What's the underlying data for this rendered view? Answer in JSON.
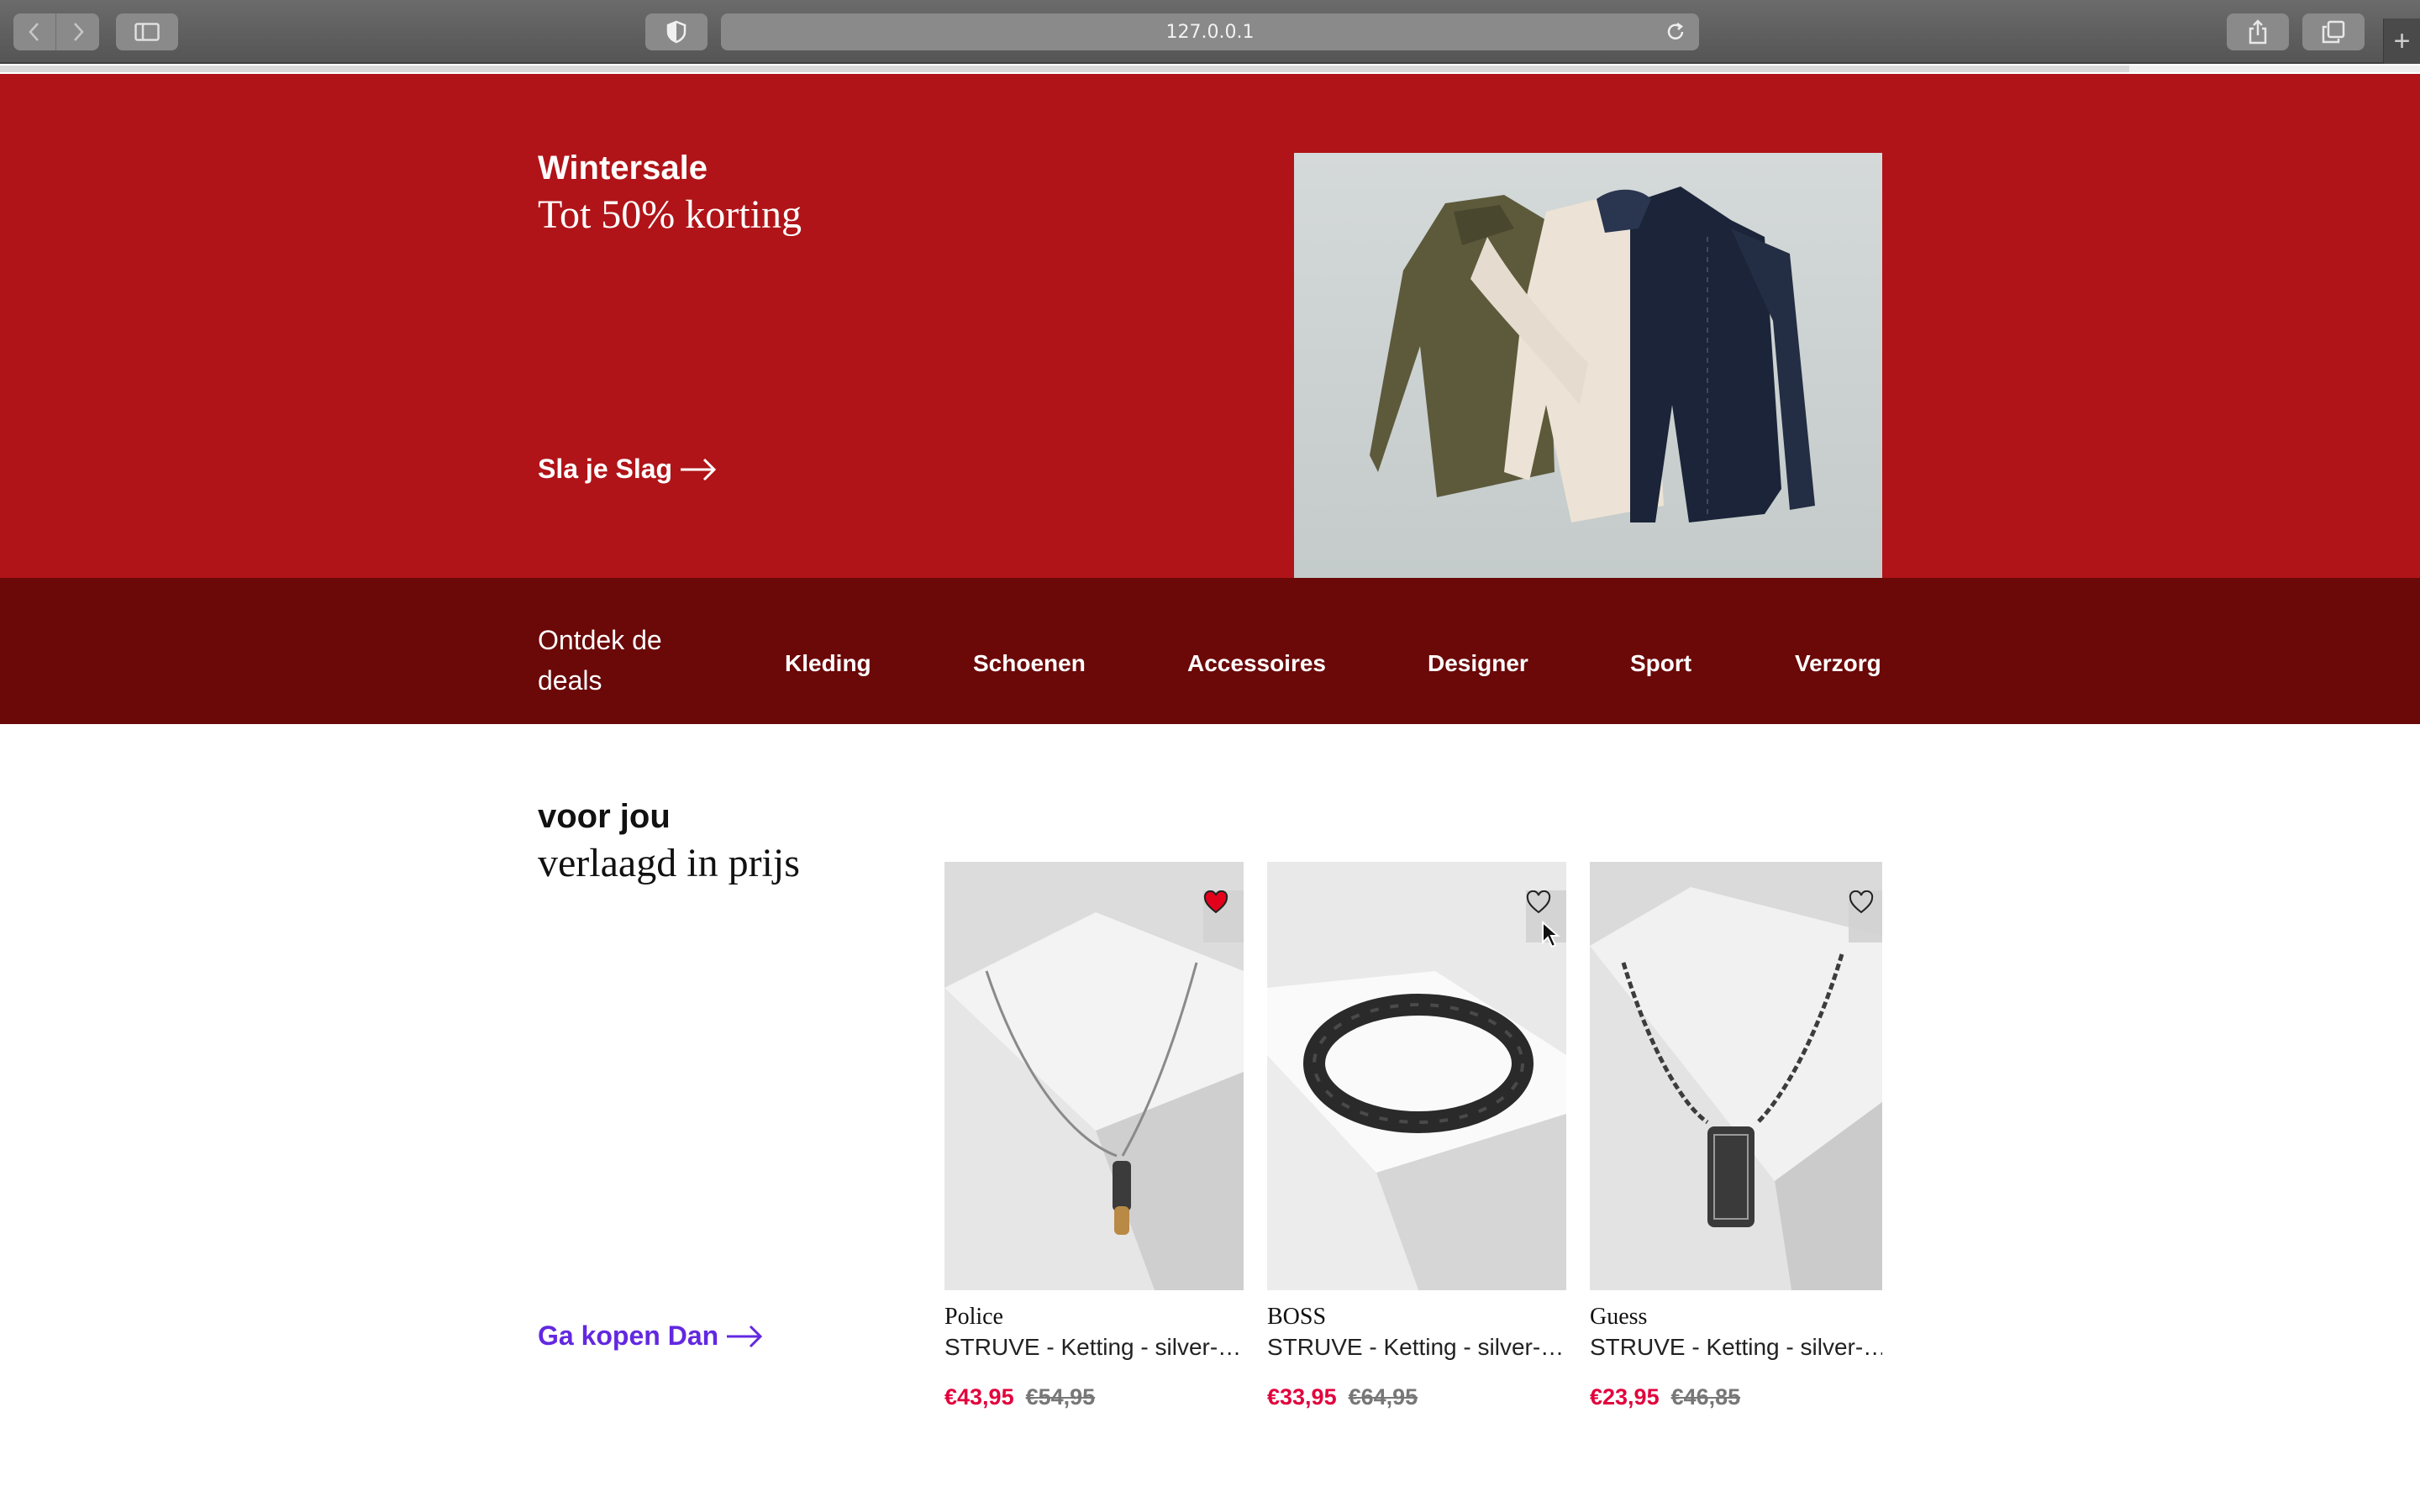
{
  "browser": {
    "url": "127.0.0.1",
    "load_progress": 0.88
  },
  "hero": {
    "kicker": "Wintersale",
    "title": "Tot 50% korting",
    "cta_label": "Sla je Slag",
    "image_alt_icon": "jackets-photo"
  },
  "category_nav": {
    "intro": "Ontdek de deals",
    "items": [
      {
        "label": "Kleding"
      },
      {
        "label": "Schoenen"
      },
      {
        "label": "Accessoires"
      },
      {
        "label": "Designer"
      },
      {
        "label": "Sport"
      },
      {
        "label": "Verzorgi"
      }
    ]
  },
  "deals": {
    "kicker": "voor jou",
    "title": "verlaagd in prijs",
    "cta_label": "Ga kopen Dan",
    "products": [
      {
        "brand": "Police",
        "name": "STRUVE - Ketting - silver-…",
        "price": "€43,95",
        "old_price": "€54,95",
        "favorited": true,
        "image": "necklace-pendant"
      },
      {
        "brand": "BOSS",
        "name": "STRUVE - Ketting - silver-…",
        "price": "€33,95",
        "old_price": "€64,95",
        "favorited": false,
        "image": "bracelet"
      },
      {
        "brand": "Guess",
        "name": "STRUVE - Ketting - silver-…",
        "price": "€23,95",
        "old_price": "€46,85",
        "favorited": false,
        "image": "dogtag-necklace"
      }
    ]
  },
  "colors": {
    "hero_bg": "#b01418",
    "nav_bg": "#6b0808",
    "sale_price": "#e2003c",
    "cta_purple": "#6328e0",
    "fav_active": "#e3001b"
  }
}
